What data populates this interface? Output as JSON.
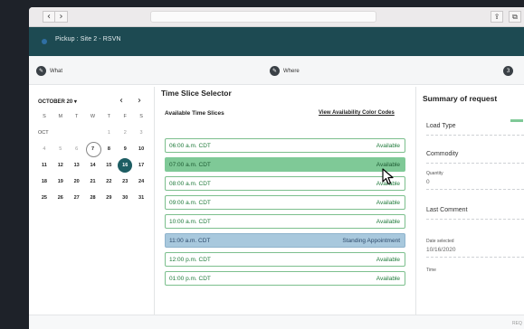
{
  "browser": {
    "back_glyph": "‹",
    "forward_glyph": "›",
    "share_icon": "share-icon",
    "tabs_icon": "tabs-icon"
  },
  "header": {
    "title": "Pickup : Site 2 - RSVN"
  },
  "stepper": [
    {
      "label": "What",
      "icon": "pencil-icon",
      "glyph": "✎"
    },
    {
      "label": "Where",
      "icon": "pencil-icon",
      "glyph": "✎"
    },
    {
      "label": "",
      "icon": "step-number",
      "glyph": "3"
    }
  ],
  "calendar": {
    "month_label": "OCTOBER 20 ▾",
    "prev": "‹",
    "next": "›",
    "weekdays": [
      "S",
      "M",
      "T",
      "W",
      "T",
      "F",
      "S"
    ],
    "month_abbrev": "OCT",
    "rows": [
      [
        "",
        "",
        "",
        "",
        "1",
        "2",
        "3"
      ],
      [
        "4",
        "5",
        "6",
        "7",
        "8",
        "9",
        "10"
      ],
      [
        "11",
        "12",
        "13",
        "14",
        "15",
        "16",
        "17"
      ],
      [
        "18",
        "19",
        "20",
        "21",
        "22",
        "23",
        "24"
      ],
      [
        "25",
        "26",
        "27",
        "28",
        "29",
        "30",
        "31"
      ]
    ],
    "today": "7",
    "selected": "16"
  },
  "time_slices": {
    "title": "Time Slice Selector",
    "subtitle": "Available Time Slices",
    "legend_link": "View Availability Color Codes",
    "slots": [
      {
        "time": "06:00 a.m. CDT",
        "status": "Available",
        "state": "available"
      },
      {
        "time": "07:00 a.m. CDT",
        "status": "Available",
        "state": "highlighted"
      },
      {
        "time": "08:00 a.m. CDT",
        "status": "Available",
        "state": "available"
      },
      {
        "time": "09:00 a.m. CDT",
        "status": "Available",
        "state": "available"
      },
      {
        "time": "10:00 a.m. CDT",
        "status": "Available",
        "state": "available"
      },
      {
        "time": "11:00 a.m. CDT",
        "status": "Standing Appointment",
        "state": "standing"
      },
      {
        "time": "12:00 p.m. CDT",
        "status": "Available",
        "state": "available"
      },
      {
        "time": "01:00 p.m. CDT",
        "status": "Available",
        "state": "available"
      }
    ]
  },
  "summary": {
    "title": "Summary of request",
    "load_type": "Load Type",
    "commodity": "Commodity",
    "quantity_label": "Quantity",
    "quantity_value": "0",
    "last_comment": "Last Comment",
    "date_label": "Date selected",
    "date_value": "10/16/2020",
    "time_label": "Time"
  },
  "footer": {
    "tag": "REQ"
  },
  "colors": {
    "header": "#1d4a52",
    "available_border": "#7cbf8d",
    "highlight": "#7fc997",
    "standing": "#a8c8dd",
    "selected_day": "#1d5d63"
  }
}
